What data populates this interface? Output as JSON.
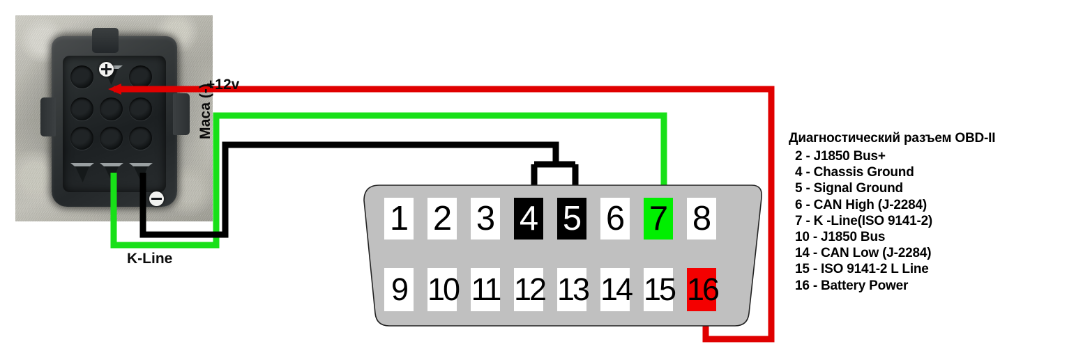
{
  "photo": {
    "alt_name": "vehicle-diagnostic-connector-photo",
    "plus_marker": "+",
    "minus_marker": "-"
  },
  "wires": {
    "power": {
      "label": "+12v",
      "color": "#e00000",
      "from": "connector-pin-top-middle",
      "to": "obd-pin-16"
    },
    "kline": {
      "label": "K-Line",
      "color": "#18e018",
      "from": "connector-pin-bottom-middle",
      "to": "obd-pin-7"
    },
    "ground": {
      "label": "Маса (-)",
      "color": "#000000",
      "from": "connector-pin-bottom-right",
      "to": "obd-pin-4-and-5"
    }
  },
  "obd_connector": {
    "name": "OBD-II diagnostic connector",
    "shell_color": "#c0c0c0",
    "top_row": [
      {
        "num": "1",
        "state": "normal"
      },
      {
        "num": "2",
        "state": "normal"
      },
      {
        "num": "3",
        "state": "normal"
      },
      {
        "num": "4",
        "state": "black"
      },
      {
        "num": "5",
        "state": "black"
      },
      {
        "num": "6",
        "state": "normal"
      },
      {
        "num": "7",
        "state": "green"
      },
      {
        "num": "8",
        "state": "normal"
      }
    ],
    "bottom_row": [
      {
        "num": "9",
        "state": "normal"
      },
      {
        "num": "10",
        "state": "normal"
      },
      {
        "num": "11",
        "state": "normal"
      },
      {
        "num": "12",
        "state": "normal"
      },
      {
        "num": "13",
        "state": "normal"
      },
      {
        "num": "14",
        "state": "normal"
      },
      {
        "num": "15",
        "state": "normal"
      },
      {
        "num": "16",
        "state": "red"
      }
    ]
  },
  "legend": {
    "title": "Диагностический разъем OBD-II",
    "rows": [
      "2 - J1850 Bus+",
      "4 - Chassis Ground",
      "5 - Signal Ground",
      "6 - CAN High (J-2284)",
      "7 -  K -Line(ISO 9141-2)",
      "10 - J1850 Bus",
      "14 - CAN Low (J-2284)",
      "15 - ISO 9141-2 L Line",
      "16 - Battery Power"
    ]
  },
  "colors": {
    "red_wire": "#e00000",
    "green_wire": "#18e018",
    "black_wire": "#000000",
    "pin_green": "#00ef00",
    "pin_red": "#f40000",
    "shell_gray": "#c0c0c0"
  }
}
